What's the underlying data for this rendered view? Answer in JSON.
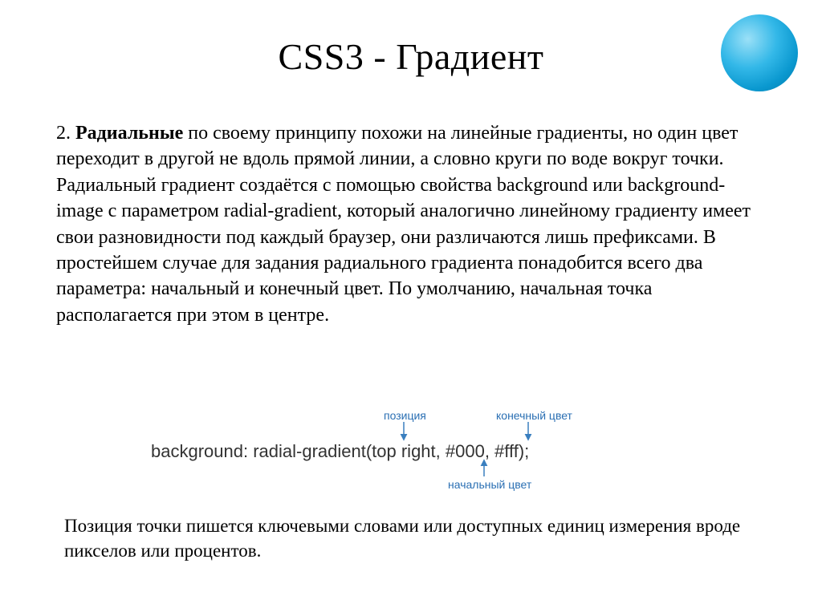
{
  "title": "CSS3 - Градиент",
  "paragraph": {
    "num": "2. ",
    "lead": "Радиальные",
    "rest": " по своему принципу похожи на линейные градиенты, но один цвет переходит в другой не вдоль прямой линии, а словно круги по воде вокруг точки. Радиальный градиент создаётся с помощью свойства background или background-image с параметром radial-gradient, который аналогично линейному градиенту имеет свои разновидности под каждый браузер, они различаются лишь префиксами. В простейшем случае для задания радиального градиента понадобится всего два параметра: начальный и конечный цвет. По умолчанию, начальная точка располагается при этом в центре."
  },
  "code": "background: radial-gradient(top right, #000, #fff);",
  "labels": {
    "position": "позиция",
    "end_color": "конечный цвет",
    "start_color": "начальный цвет"
  },
  "footnote": "Позиция точки пишется ключевыми словами или доступных единиц измерения вроде пикселов или процентов.",
  "colors": {
    "label": "#2a6fb3",
    "arrow": "#3a7fbf",
    "ball_light": "#9be0f7",
    "ball_dark": "#067aa8"
  }
}
